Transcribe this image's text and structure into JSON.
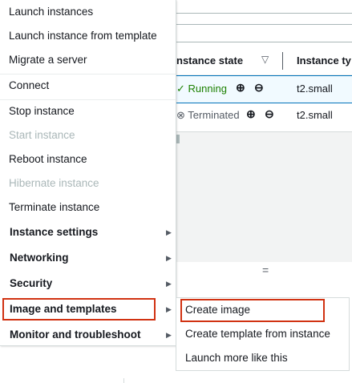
{
  "table": {
    "header": {
      "state_label": "nstance state",
      "type_label": "Instance ty",
      "sort_icon": "sort-down-icon"
    },
    "rows": [
      {
        "state": "Running",
        "type": "t2.small",
        "selected": true
      },
      {
        "state": "Terminated",
        "type": "t2.small",
        "selected": false
      }
    ],
    "resizer_glyph": "="
  },
  "menu": {
    "items": [
      {
        "label": "Launch instances",
        "kind": "action",
        "enabled": true
      },
      {
        "label": "Launch instance from template",
        "kind": "action",
        "enabled": true
      },
      {
        "label": "Migrate a server",
        "kind": "action",
        "enabled": true
      },
      {
        "label": "Connect",
        "kind": "action",
        "enabled": true
      },
      {
        "label": "Stop instance",
        "kind": "action",
        "enabled": true
      },
      {
        "label": "Start instance",
        "kind": "action",
        "enabled": false
      },
      {
        "label": "Reboot instance",
        "kind": "action",
        "enabled": true
      },
      {
        "label": "Hibernate instance",
        "kind": "action",
        "enabled": false
      },
      {
        "label": "Terminate instance",
        "kind": "action",
        "enabled": true
      },
      {
        "label": "Instance settings",
        "kind": "group",
        "enabled": true
      },
      {
        "label": "Networking",
        "kind": "group",
        "enabled": true
      },
      {
        "label": "Security",
        "kind": "group",
        "enabled": true
      },
      {
        "label": "Image and templates",
        "kind": "group",
        "enabled": true,
        "highlighted": true
      },
      {
        "label": "Monitor and troubleshoot",
        "kind": "group",
        "enabled": true
      }
    ],
    "arrow_glyph": "▶"
  },
  "submenu": {
    "items": [
      {
        "label": "Create image",
        "highlighted": true
      },
      {
        "label": "Create template from instance"
      },
      {
        "label": "Launch more like this"
      }
    ]
  },
  "colors": {
    "running": "#1d8102",
    "highlight_border": "#d13212",
    "selected_row": "#f1faff"
  }
}
